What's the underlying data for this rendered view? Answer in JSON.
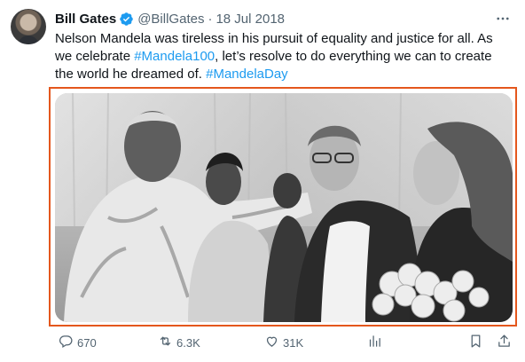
{
  "tweet": {
    "author_name": "Bill Gates",
    "handle": "@BillGates",
    "separator": "·",
    "date": "18 Jul 2018",
    "text_parts": {
      "l1": "Nelson Mandela was tireless in his pursuit of equality and justice for all. As",
      "l2_a": "we celebrate ",
      "l2_tag": "#Mandela100",
      "l2_b": ", let’s resolve to do everything we can to create",
      "l3_a": "the world he dreamed of. ",
      "l3_tag": "#MandelaDay"
    }
  },
  "metrics": {
    "replies": "670",
    "reposts": "6.3K",
    "likes": "31K"
  },
  "icons": {
    "verified": "verified-badge-icon",
    "more": "more-options-icon",
    "reply": "reply-icon",
    "repost": "repost-icon",
    "like": "like-icon",
    "views": "views-icon",
    "bookmark": "bookmark-icon",
    "share": "share-icon"
  },
  "colors": {
    "hashtag": "#1d9bf0",
    "verified": "#1d9bf0",
    "highlight_border": "#e4571d",
    "muted_text": "#536471"
  }
}
